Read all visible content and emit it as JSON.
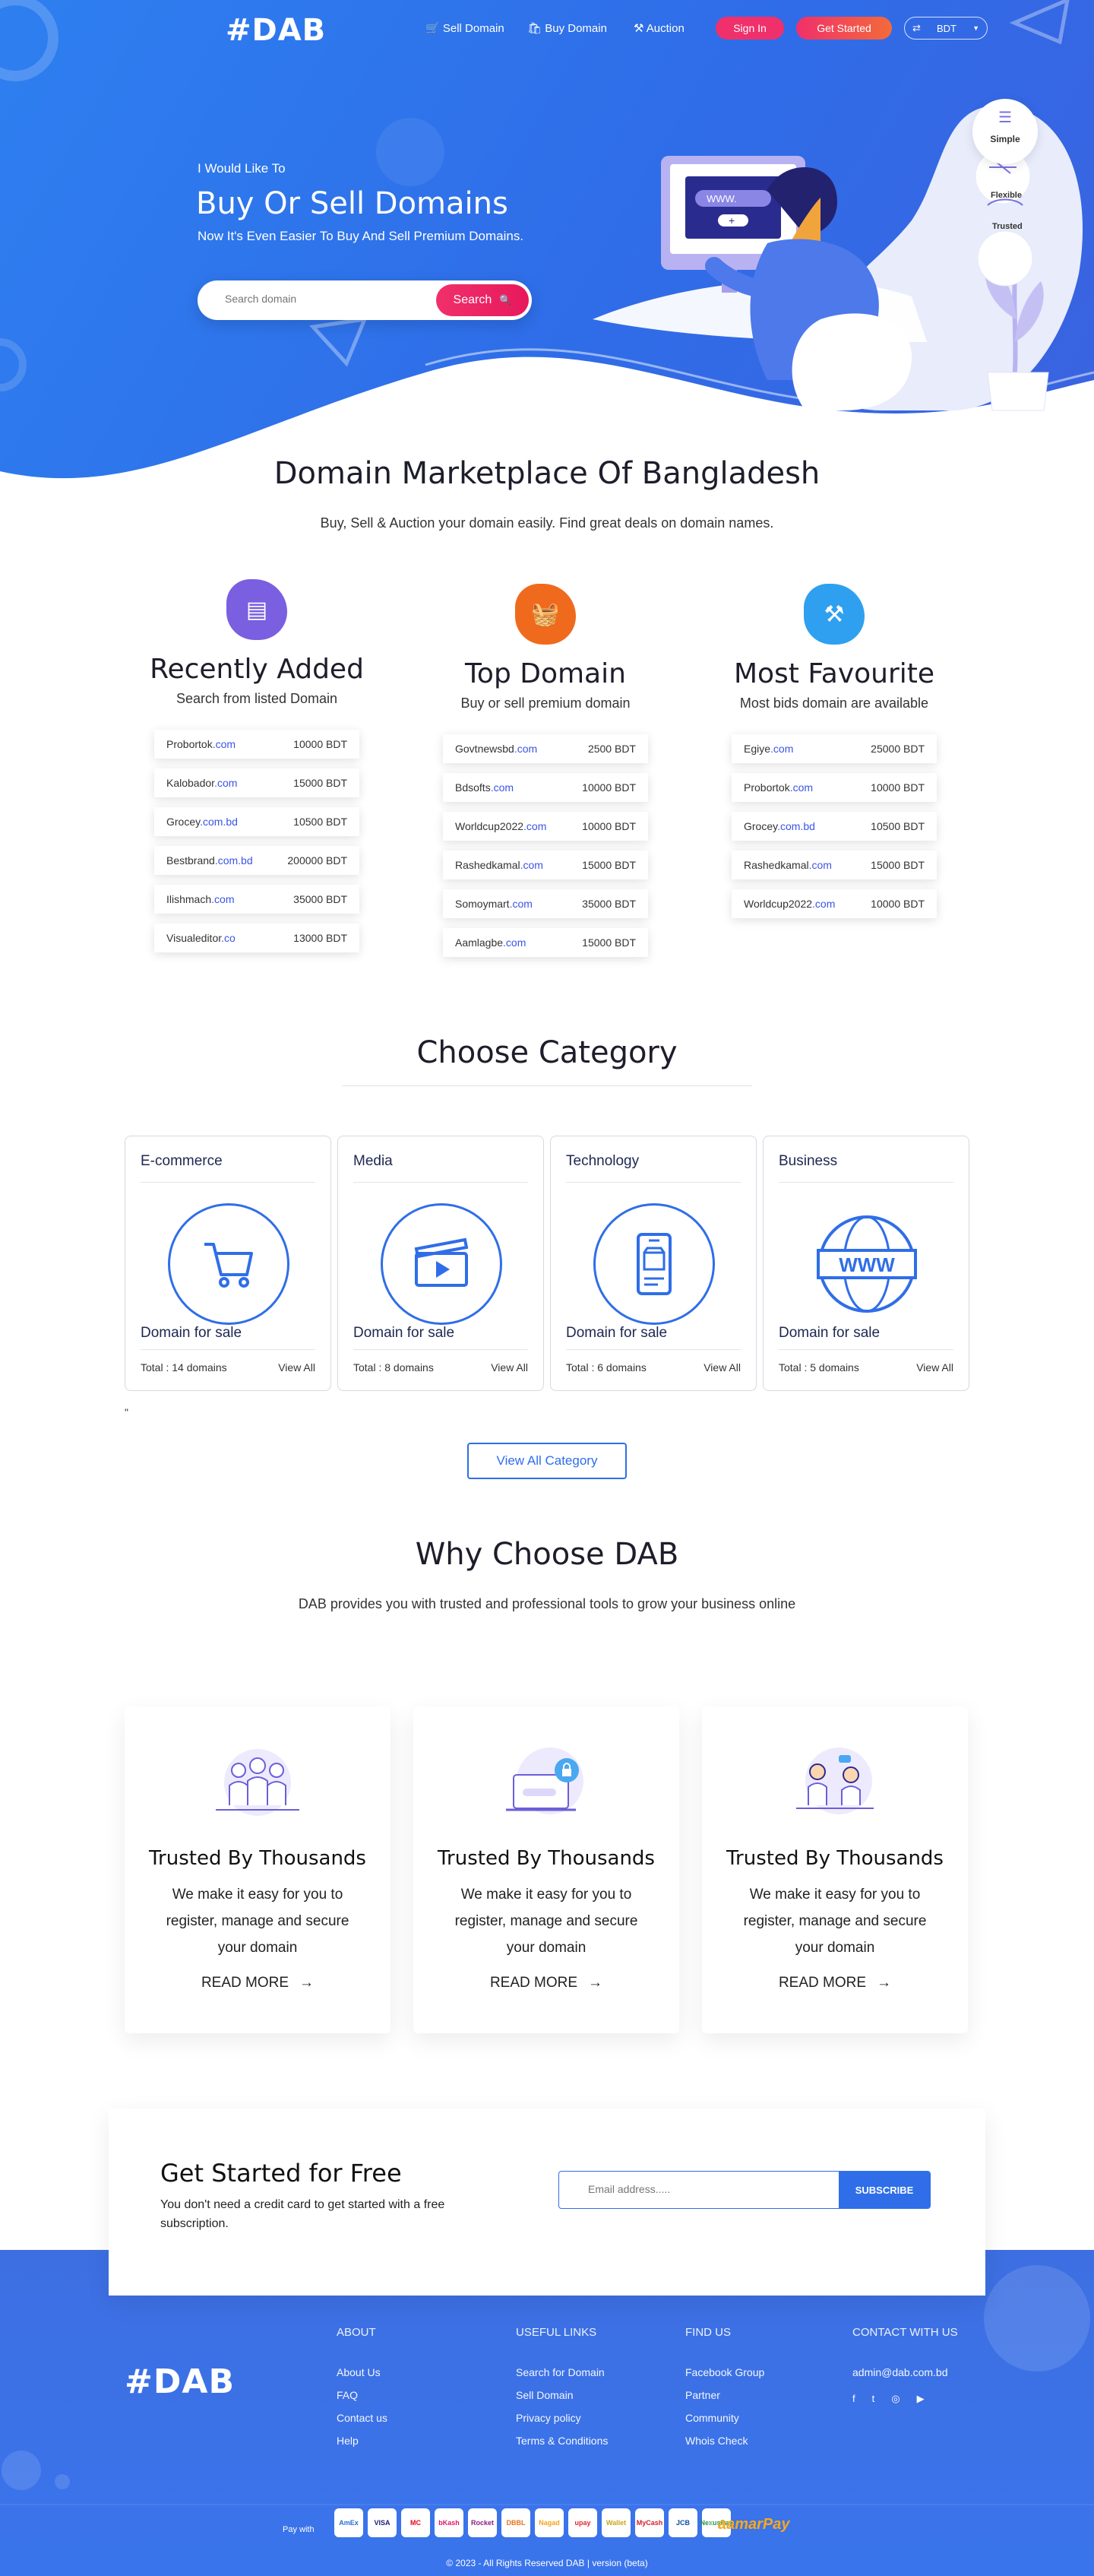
{
  "nav": {
    "logo": "#DAB",
    "sell": "Sell Domain",
    "buy": "Buy Domain",
    "auction": "Auction",
    "signin": "Sign In",
    "get_started": "Get Started",
    "currency": "BDT"
  },
  "hero": {
    "kicker": "I Would Like To",
    "title": "Buy Or Sell Domains",
    "subtitle": "Now It's Even Easier To Buy And Sell Premium Domains.",
    "search_placeholder": "Search domain",
    "search_button": "Search",
    "monitor_text": "WWW.",
    "badges": [
      "Simple",
      "Flexible",
      "Trusted"
    ]
  },
  "market": {
    "title": "Domain Marketplace Of Bangladesh",
    "subtitle": "Buy, Sell & Auction your domain easily. Find great deals on domain names.",
    "columns": [
      {
        "title": "Recently Added",
        "desc": "Search from listed Domain",
        "icon": "list-icon",
        "color": "#7a5fe0",
        "rows": [
          {
            "name": "Probortok",
            "tld": ".com",
            "price": "10000 BDT"
          },
          {
            "name": "Kalobador",
            "tld": ".com",
            "price": "15000 BDT"
          },
          {
            "name": "Grocey",
            "tld": ".com.bd",
            "price": "10500 BDT"
          },
          {
            "name": "Bestbrand",
            "tld": ".com.bd",
            "price": "200000 BDT"
          },
          {
            "name": "Ilishmach",
            "tld": ".com",
            "price": "35000 BDT"
          },
          {
            "name": "Visualeditor",
            "tld": ".co",
            "price": "13000 BDT"
          }
        ]
      },
      {
        "title": "Top Domain",
        "desc": "Buy or sell premium domain",
        "icon": "basket-icon",
        "color": "#f06a1e",
        "rows": [
          {
            "name": "Govtnewsbd",
            "tld": ".com",
            "price": "2500 BDT"
          },
          {
            "name": "Bdsofts",
            "tld": ".com",
            "price": "10000 BDT"
          },
          {
            "name": "Worldcup2022",
            "tld": ".com",
            "price": "10000 BDT"
          },
          {
            "name": "Rashedkamal",
            "tld": ".com",
            "price": "15000 BDT"
          },
          {
            "name": "Somoymart",
            "tld": ".com",
            "price": "35000 BDT"
          },
          {
            "name": "Aamlagbe",
            "tld": ".com",
            "price": "15000 BDT"
          }
        ]
      },
      {
        "title": "Most Favourite",
        "desc": "Most bids domain are available",
        "icon": "gavel-icon",
        "color": "#2fa0ef",
        "rows": [
          {
            "name": "Egiye",
            "tld": ".com",
            "price": "25000 BDT"
          },
          {
            "name": "Probortok",
            "tld": ".com",
            "price": "10000 BDT"
          },
          {
            "name": "Grocey",
            "tld": ".com.bd",
            "price": "10500 BDT"
          },
          {
            "name": "Rashedkamal",
            "tld": ".com",
            "price": "15000 BDT"
          },
          {
            "name": "Worldcup2022",
            "tld": ".com",
            "price": "10000 BDT"
          }
        ]
      }
    ]
  },
  "category": {
    "title": "Choose Category",
    "items": [
      {
        "name": "E-commerce",
        "icon": "cart-icon",
        "for_sale": "Domain for sale",
        "total": "Total : 14 domains",
        "view": "View All"
      },
      {
        "name": "Media",
        "icon": "video-icon",
        "for_sale": "Domain for sale",
        "total": "Total : 8 domains",
        "view": "View All"
      },
      {
        "name": "Technology",
        "icon": "phone-icon",
        "for_sale": "Domain for sale",
        "total": "Total : 6 domains",
        "view": "View All"
      },
      {
        "name": "Business",
        "icon": "www-icon",
        "for_sale": "Domain for sale",
        "total": "Total : 5 domains",
        "view": "View All"
      }
    ],
    "stray_mark": "\"",
    "view_all": "View All Category"
  },
  "why": {
    "title": "Why Choose DAB",
    "subtitle": "DAB provides you with trusted and professional tools to grow your business online",
    "cards": [
      {
        "title": "Trusted By Thousands",
        "text": "We make it easy for you to register, manage and secure your domain",
        "read_more": "READ MORE",
        "icon": "team-icon"
      },
      {
        "title": "Trusted By Thousands",
        "text": "We make it easy for you to register, manage and secure your domain",
        "read_more": "READ MORE",
        "icon": "secure-laptop-icon"
      },
      {
        "title": "Trusted By Thousands",
        "text": "We make it easy for you to register, manage and secure your domain",
        "read_more": "READ MORE",
        "icon": "support-icon"
      }
    ]
  },
  "cta": {
    "title": "Get Started for Free",
    "text": "You don't need a credit card to get started with a free subscription.",
    "email_placeholder": "Email address.....",
    "button": "SUBSCRIBE"
  },
  "footer": {
    "logo": "#DAB",
    "about": {
      "title": "ABOUT",
      "links": [
        "About Us",
        "FAQ",
        "Contact us",
        "Help"
      ]
    },
    "useful": {
      "title": "USEFUL LINKS",
      "links": [
        "Search for Domain",
        "Sell Domain",
        "Privacy policy",
        "Terms & Conditions"
      ]
    },
    "find": {
      "title": "FIND US",
      "links": [
        "Facebook Group",
        "Partner",
        "Community",
        "Whois Check"
      ]
    },
    "contact": {
      "title": "CONTACT WITH US",
      "email": "admin@dab.com.bd"
    },
    "pay_with": "Pay with",
    "payments": [
      "AmEx",
      "VISA",
      "MC",
      "bKash",
      "Rocket",
      "DBBL",
      "Nagad",
      "upay",
      "Wallet",
      "MyCash",
      "JCB",
      "NexusPay"
    ],
    "secured_by": "aamarPay",
    "copyright": "© 2023 - All Rights Reserved DAB | version (beta)"
  }
}
